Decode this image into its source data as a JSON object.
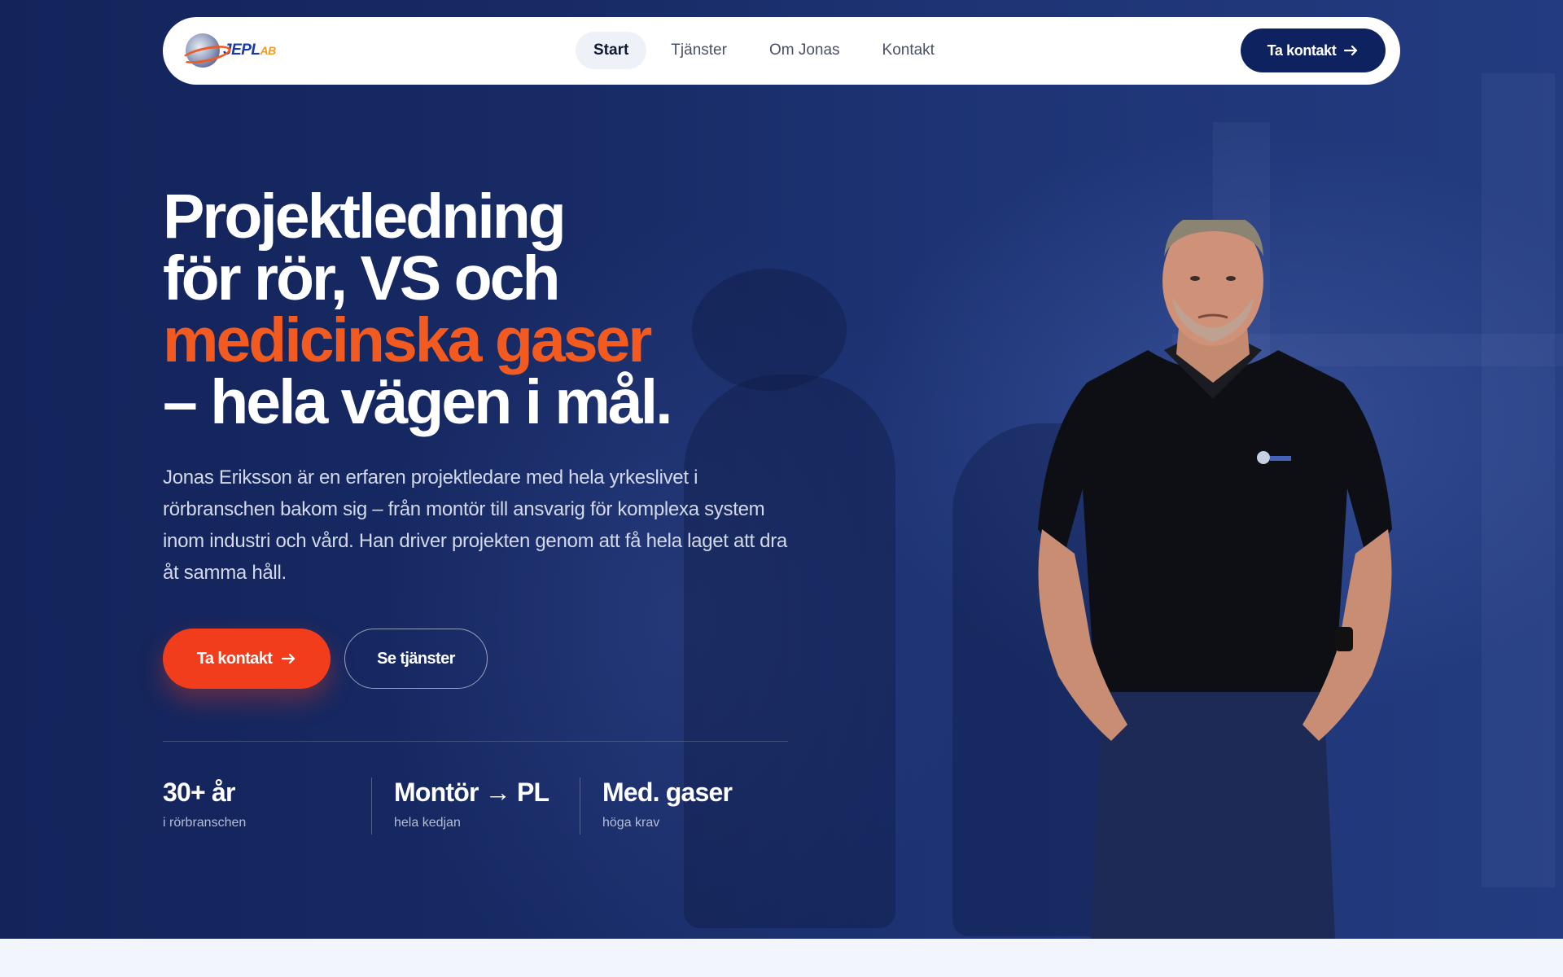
{
  "nav": {
    "logo_text": "JEPL",
    "logo_suffix": "AB",
    "links": [
      {
        "label": "Start",
        "active": true
      },
      {
        "label": "Tjänster",
        "active": false
      },
      {
        "label": "Om Jonas",
        "active": false
      },
      {
        "label": "Kontakt",
        "active": false
      }
    ],
    "cta_label": "Ta kontakt",
    "cta_icon": "arrow-right-icon"
  },
  "hero": {
    "headline_line1": "Projektledning",
    "headline_line2": "för rör, VS och",
    "headline_accent": "medicinska gaser",
    "headline_line4": "– hela vägen i mål.",
    "lead": "Jonas Eriksson är en erfaren projektledare med hela yrkeslivet i rörbranschen bakom sig – från montör till ansvarig för komplexa system inom industri och vård. Han driver projekten genom att få hela laget att dra åt samma håll.",
    "primary_button": "Ta kontakt",
    "secondary_button": "Se tjänster",
    "stats": [
      {
        "value": "30+ år",
        "label": "i rörbranschen"
      },
      {
        "value": "Montör → PL",
        "label": "hela kedjan"
      },
      {
        "value": "Med. gaser",
        "label": "höga krav"
      }
    ]
  },
  "colors": {
    "hero_bg": "#172a64",
    "accent": "#f35a1f",
    "primary_button": "#f23d1c",
    "nav_cta": "#0f2260"
  }
}
